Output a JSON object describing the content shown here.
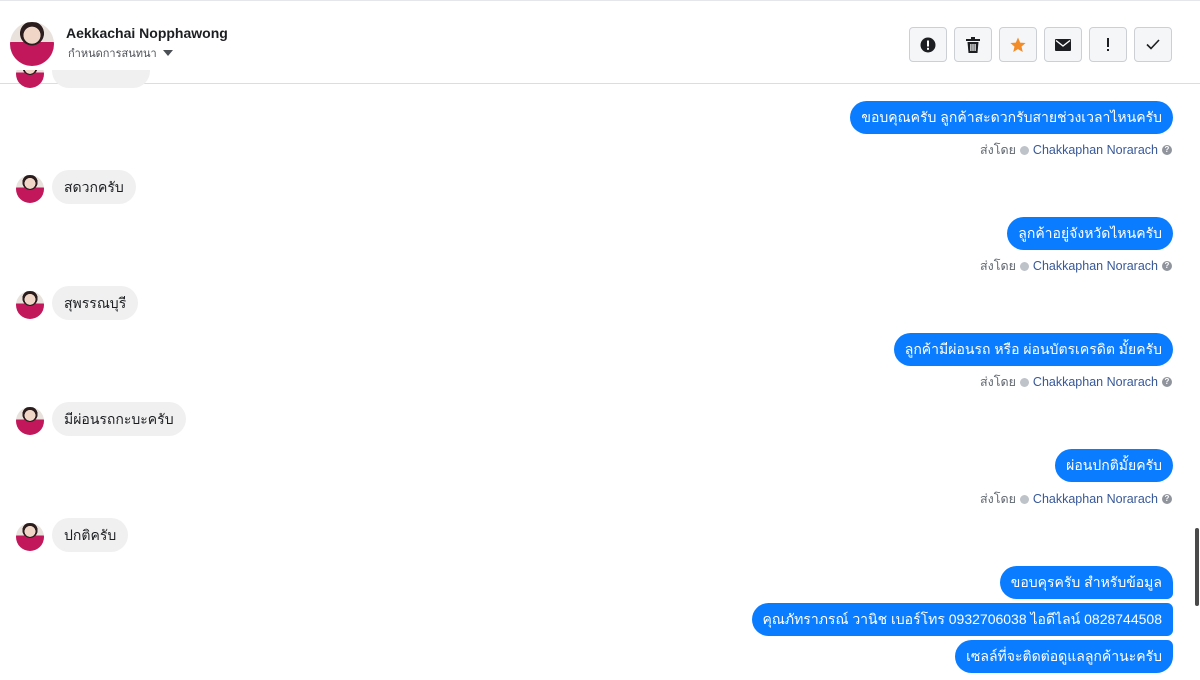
{
  "header": {
    "contact_name": "Aekkachai Nopphawong",
    "conversation_action": "กำหนดการสนทนา",
    "toolbar": [
      {
        "name": "mark-spam-button",
        "icon": "alert-circle-icon"
      },
      {
        "name": "delete-button",
        "icon": "trash-icon"
      },
      {
        "name": "star-button",
        "icon": "star-icon"
      },
      {
        "name": "mark-unread-button",
        "icon": "envelope-icon"
      },
      {
        "name": "important-button",
        "icon": "exclamation-icon"
      },
      {
        "name": "mark-done-button",
        "icon": "checkmark-icon"
      }
    ]
  },
  "colors": {
    "outgoing_bubble": "#0a7cff",
    "incoming_bubble": "#f0f0f0",
    "sender_link": "#385898",
    "star": "#f28c28"
  },
  "messages": [
    {
      "direction": "out",
      "text": "ขอบคุณครับ ลูกค้าสะดวกรับสายช่วงเวลาไหนครับ"
    },
    {
      "direction": "in",
      "text": "สดวกครับ"
    },
    {
      "direction": "out",
      "text": "ลูกค้าอยู่จังหวัดไหนครับ"
    },
    {
      "direction": "in",
      "text": "สุพรรณบุรี"
    },
    {
      "direction": "out",
      "text": "ลูกค้ามีผ่อนรถ หรือ ผ่อนบัตรเครดิต มั้ยครับ"
    },
    {
      "direction": "in",
      "text": "มีผ่อนรถกะบะครับ"
    },
    {
      "direction": "out",
      "text": "ผ่อนปกติมั้ยครับ"
    },
    {
      "direction": "in",
      "text": "ปกติครับ"
    },
    {
      "direction": "out",
      "text": "ขอบคุรครับ สำหรับข้อมูล"
    },
    {
      "direction": "out",
      "text": "คุณภัทราภรณ์  วานิช      เบอร์โทร 0932706038  ไอดีไลน์ 0828744508"
    },
    {
      "direction": "out",
      "text": "เซลล์ที่จะติดต่อดูแลลูกค้านะครับ"
    }
  ],
  "sent_by": {
    "prefix": "ส่งโดย",
    "sender": "Chakkaphan Norarach",
    "help": "?"
  }
}
